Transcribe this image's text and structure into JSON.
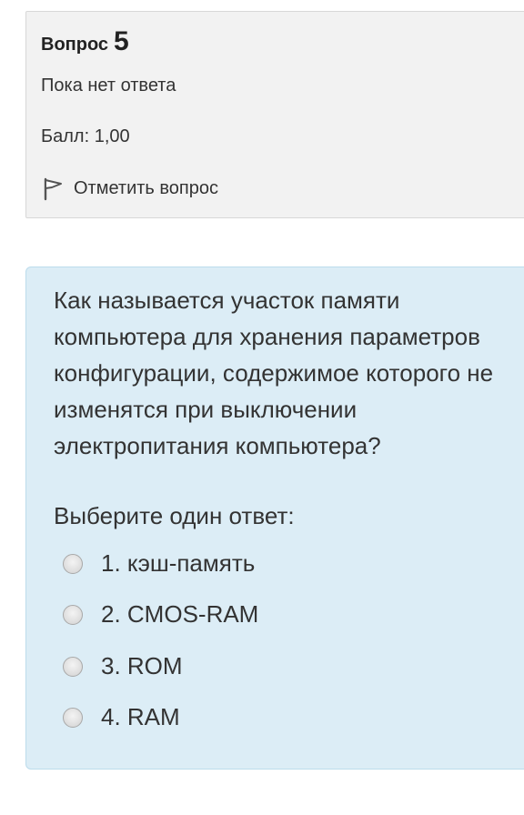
{
  "info": {
    "question_label": "Вопрос",
    "question_number": "5",
    "state": "Пока нет ответа",
    "grade": "Балл: 1,00",
    "flag_label": "Отметить вопрос"
  },
  "question": {
    "text": "Как называется участок памяти\nкомпьютера для хранения параметров\nконфигурации, содержимое которого не\nизменятся при выключении\nэлектропитания компьютера?",
    "prompt": "Выберите один ответ:",
    "options": [
      {
        "label": "1. кэш-память",
        "selected": false
      },
      {
        "label": "2. CMOS-RAM",
        "selected": false
      },
      {
        "label": "3. ROM",
        "selected": false
      },
      {
        "label": "4. RAM",
        "selected": false
      }
    ]
  },
  "colors": {
    "info_bg": "#f2f2f2",
    "formulation_bg": "#dcedf6",
    "formulation_border": "#bcdcec"
  },
  "icons": {
    "flag": "flag-icon",
    "radio": "radio-unchecked-icon"
  }
}
